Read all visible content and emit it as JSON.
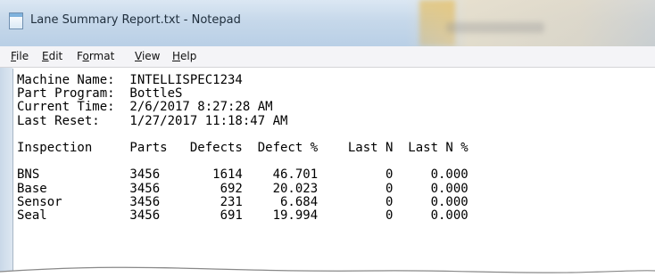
{
  "window": {
    "title": "Lane Summary Report.txt - Notepad",
    "icon": "notepad-icon"
  },
  "menu": {
    "file": {
      "mnemonic": "F",
      "rest": "ile"
    },
    "edit": {
      "mnemonic": "E",
      "rest": "dit"
    },
    "format": {
      "pre": "F",
      "mnemonic": "o",
      "rest": "rmat"
    },
    "view": {
      "mnemonic": "V",
      "rest": "iew"
    },
    "help": {
      "mnemonic": "H",
      "rest": "elp"
    }
  },
  "document": {
    "lines": [
      "Machine Name:  INTELLISPEC1234",
      "Part Program:  BottleS",
      "Current Time:  2/6/2017 8:27:28 AM",
      "Last Reset:    1/27/2017 11:18:47 AM",
      "",
      "Inspection     Parts   Defects  Defect %    Last N  Last N %",
      "",
      "BNS            3456       1614    46.701         0     0.000",
      "Base           3456        692    20.023         0     0.000",
      "Sensor         3456        231     6.684         0     0.000",
      "Seal           3456        691    19.994         0     0.000"
    ]
  },
  "colors": {
    "titlebar": "#c6d8ea",
    "menubar": "#f4f4f7",
    "text": "#000000"
  }
}
